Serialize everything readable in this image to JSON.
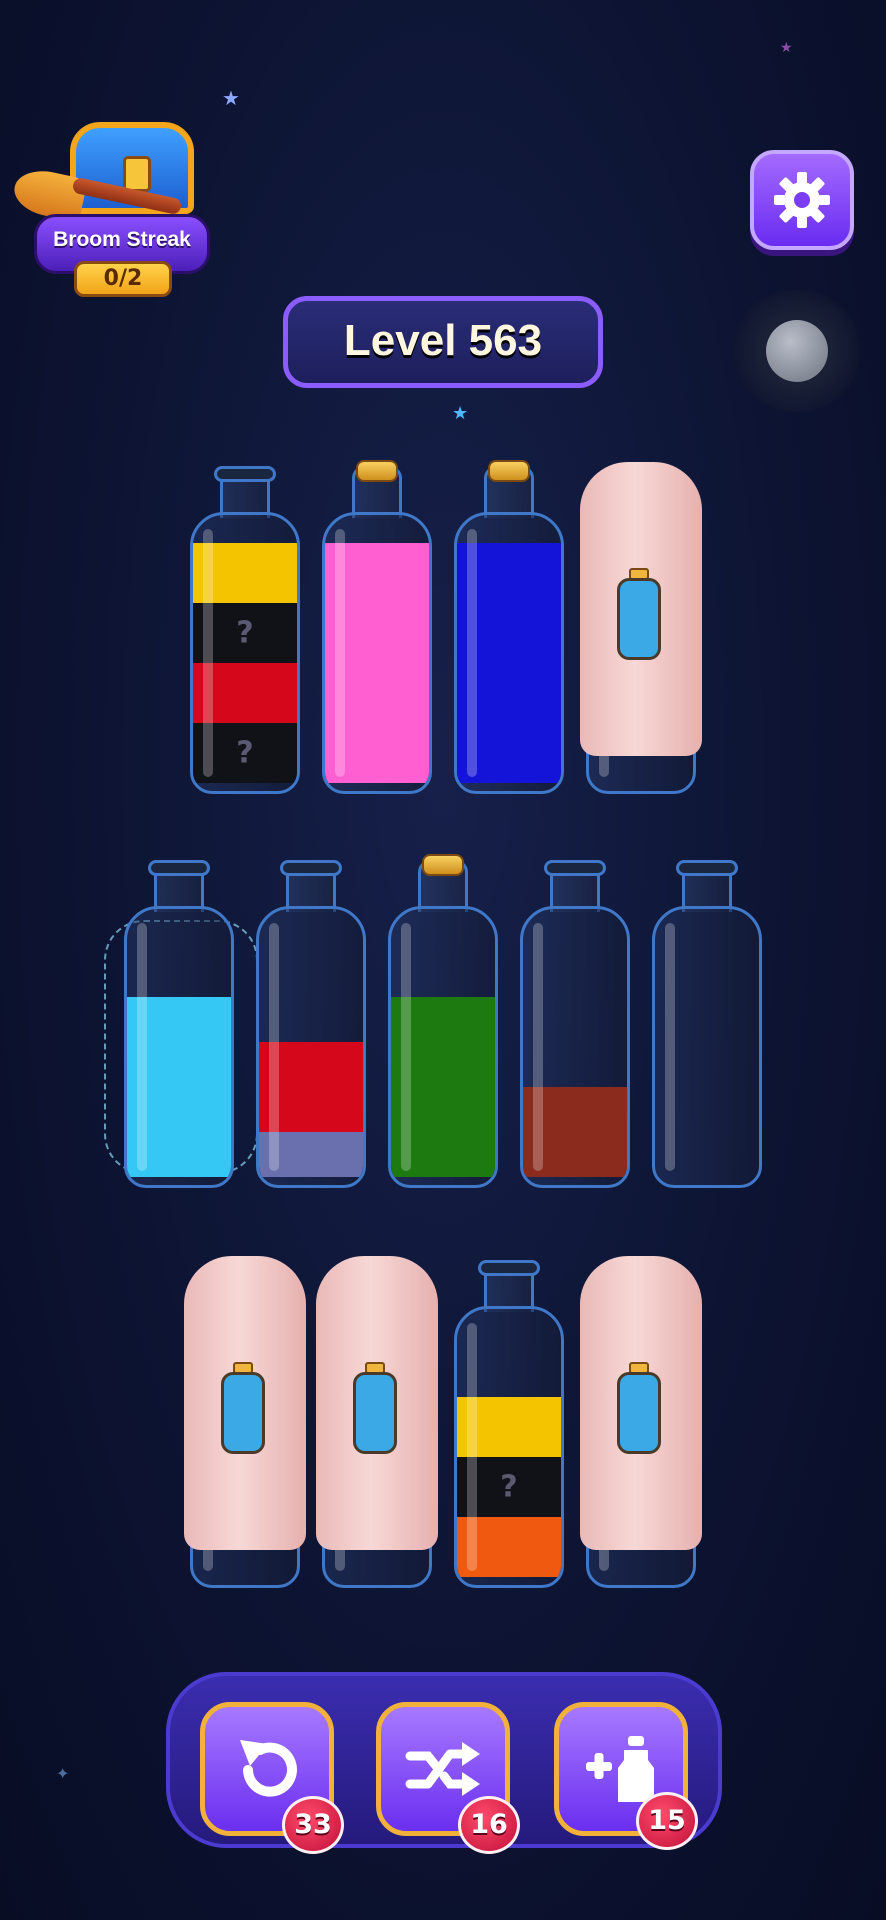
{
  "broom_streak": {
    "label": "Broom Streak",
    "count": "0/2"
  },
  "level": {
    "label": "Level 563"
  },
  "icons": {
    "settings": "gear-icon",
    "undo": "undo-icon",
    "shuffle": "shuffle-icon",
    "add_bottle": "add-bottle-icon"
  },
  "colors": {
    "yellow": "#f5c400",
    "black": "#111118",
    "red": "#d4081a",
    "pink": "#ff5fd0",
    "blue": "#1414d8",
    "light_blue": "#35c8f4",
    "lavender": "#6a6fae",
    "green": "#1c7a10",
    "brown": "#8b2b1e",
    "orange": "#f05a10"
  },
  "bottles": [
    {
      "row": 1,
      "cork": false,
      "covered": false,
      "layers": [
        {
          "color": "yellow",
          "level": 1,
          "hidden": false
        },
        {
          "color": "black",
          "level": 1,
          "hidden": true,
          "mark": "?"
        },
        {
          "color": "red",
          "level": 1,
          "hidden": false
        },
        {
          "color": "black",
          "level": 1,
          "hidden": true,
          "mark": "?"
        }
      ]
    },
    {
      "row": 1,
      "cork": true,
      "covered": false,
      "layers": [
        {
          "color": "pink",
          "level": 4,
          "hidden": false
        }
      ]
    },
    {
      "row": 1,
      "cork": true,
      "covered": false,
      "layers": [
        {
          "color": "blue",
          "level": 4,
          "hidden": false
        }
      ]
    },
    {
      "row": 1,
      "cork": false,
      "covered": true,
      "layers": []
    },
    {
      "row": 2,
      "cork": false,
      "covered": false,
      "selected": true,
      "layers": [
        {
          "color": "light_blue",
          "level": 3,
          "hidden": false
        }
      ]
    },
    {
      "row": 2,
      "cork": false,
      "covered": false,
      "layers": [
        {
          "color": "red",
          "level": 1.5,
          "hidden": false
        },
        {
          "color": "lavender",
          "level": 0.75,
          "hidden": false
        }
      ]
    },
    {
      "row": 2,
      "cork": true,
      "covered": false,
      "layers": [
        {
          "color": "green",
          "level": 3,
          "hidden": false
        }
      ]
    },
    {
      "row": 2,
      "cork": false,
      "covered": false,
      "layers": [
        {
          "color": "brown",
          "level": 1.5,
          "hidden": false
        }
      ]
    },
    {
      "row": 2,
      "cork": false,
      "covered": false,
      "layers": []
    },
    {
      "row": 3,
      "cork": false,
      "covered": true,
      "layers": []
    },
    {
      "row": 3,
      "cork": false,
      "covered": true,
      "layers": []
    },
    {
      "row": 3,
      "cork": false,
      "covered": false,
      "layers": [
        {
          "color": "yellow",
          "level": 1,
          "hidden": false
        },
        {
          "color": "black",
          "level": 1,
          "hidden": true,
          "mark": "?"
        },
        {
          "color": "orange",
          "level": 1,
          "hidden": false
        }
      ]
    },
    {
      "row": 3,
      "cork": false,
      "covered": true,
      "layers": []
    }
  ],
  "tools": [
    {
      "name": "undo",
      "count": "33"
    },
    {
      "name": "shuffle",
      "count": "16"
    },
    {
      "name": "add_bottle",
      "count": "15"
    }
  ]
}
